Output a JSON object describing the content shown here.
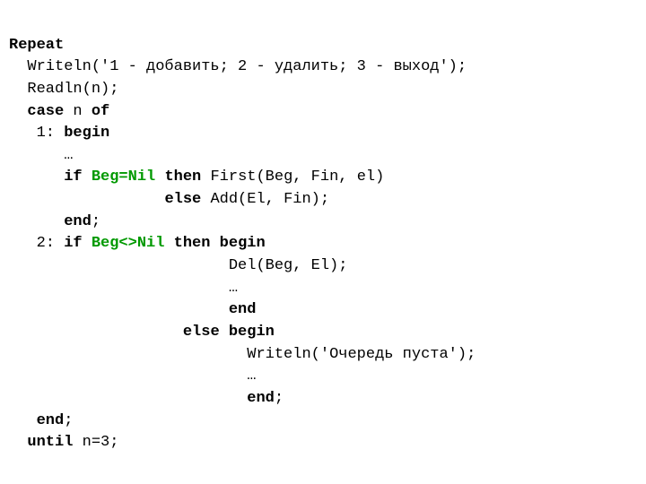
{
  "code": {
    "repeat": "Repeat",
    "writeln_menu": "  Writeln('1 - добавить; 2 - удалить; 3 - выход');",
    "readln": "  Readln(n);",
    "case_kw": "case",
    "case_var": " n ",
    "of_kw": "of",
    "c1_label": "   1: ",
    "begin1": "begin",
    "dots1": "      …",
    "if1_pre": "      ",
    "if1_kw": "if",
    "beg_eq_nil": " Beg=Nil ",
    "then1": "then",
    "first_call": " First(Beg, Fin, el)",
    "else1_pre": "                 ",
    "else1": "else",
    "add_call": " Add(El, Fin);",
    "end1_pre": "      ",
    "end1": "end",
    "end1_sc": ";",
    "c2_label": "   2: ",
    "if2_kw": "if",
    "beg_ne_nil": " Beg<>Nil ",
    "then2": "then",
    "begin2_sp": " ",
    "begin2": "begin",
    "del_pre": "                        ",
    "del_call": "Del(Beg, El);",
    "dots2_pre": "                        ",
    "dots2": "…",
    "end2_pre": "                        ",
    "end2": "end",
    "else2_pre": "                   ",
    "else2": "else",
    "begin3_sp": " ",
    "begin3": "begin",
    "wr2_pre": "                          ",
    "writeln_empty": "Writeln('Очередь пуста');",
    "dots3_pre": "                          ",
    "dots3": "…",
    "end3_pre": "                          ",
    "end3": "end",
    "end3_sc": ";",
    "endcase_pre": "   ",
    "endcase": "end",
    "endcase_sc": ";",
    "until_pre": "  ",
    "until_kw": "until",
    "until_cond": " n=3;"
  }
}
